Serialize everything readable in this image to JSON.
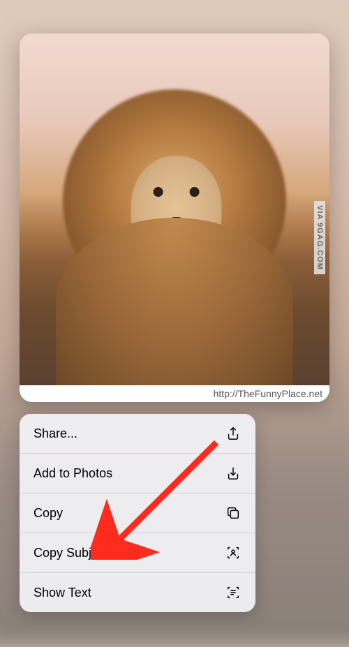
{
  "image": {
    "watermark_side": "VIA 9GAG.COM",
    "watermark_bottom": "http://TheFunnyPlace.net"
  },
  "menu": {
    "items": [
      {
        "label": "Share...",
        "icon": "share-icon"
      },
      {
        "label": "Add to Photos",
        "icon": "download-icon"
      },
      {
        "label": "Copy",
        "icon": "copy-icon"
      },
      {
        "label": "Copy Subject",
        "icon": "subject-icon"
      },
      {
        "label": "Show Text",
        "icon": "text-scan-icon"
      }
    ]
  }
}
